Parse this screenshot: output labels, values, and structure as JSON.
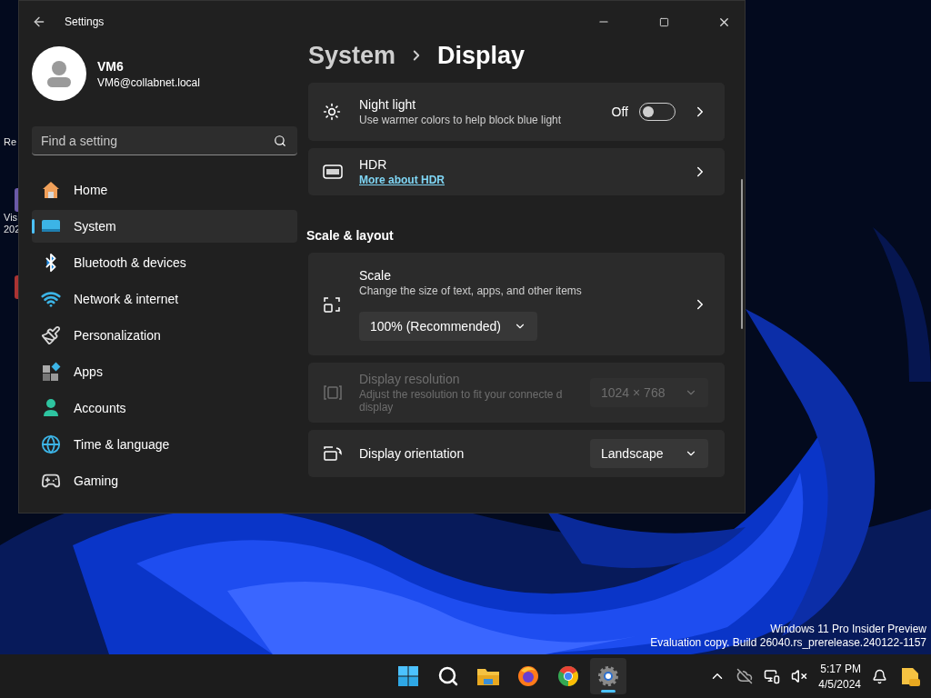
{
  "desktop_icons": [
    {
      "lines": [
        "Re"
      ]
    },
    {
      "lines": [
        "Vis",
        "202"
      ]
    }
  ],
  "window": {
    "title": "Settings"
  },
  "user": {
    "name": "VM6",
    "email": "VM6@collabnet.local"
  },
  "search": {
    "placeholder": "Find a setting"
  },
  "nav": [
    {
      "label": "Home",
      "selected": false
    },
    {
      "label": "System",
      "selected": true
    },
    {
      "label": "Bluetooth & devices",
      "selected": false
    },
    {
      "label": "Network & internet",
      "selected": false
    },
    {
      "label": "Personalization",
      "selected": false
    },
    {
      "label": "Apps",
      "selected": false
    },
    {
      "label": "Accounts",
      "selected": false
    },
    {
      "label": "Time & language",
      "selected": false
    },
    {
      "label": "Gaming",
      "selected": false
    }
  ],
  "breadcrumb": [
    "System",
    "Display"
  ],
  "items": [
    {
      "kind": "toggle",
      "title": "Night light",
      "description": "Use warmer colors to help block blue light",
      "toggle": {
        "label": "Off",
        "on": false
      },
      "chevron": true,
      "disabled": false
    },
    {
      "kind": "link",
      "title": "HDR",
      "link": "More about HDR",
      "chevron": true,
      "disabled": false
    },
    {
      "kind": "heading",
      "title": "Scale & layout"
    },
    {
      "kind": "stacked",
      "title": "Scale",
      "description": "Change the size of text, apps, and other items",
      "dropdown": {
        "value": "100% (Recommended)"
      },
      "chevron": true,
      "disabled": false
    },
    {
      "kind": "inline",
      "title": "Display resolution",
      "description": "Adjust the resolution to fit your connecte d display",
      "dropdown": {
        "value": "1024 × 768"
      },
      "chevron": false,
      "disabled": true
    },
    {
      "kind": "inline",
      "title": "Display orientation",
      "dropdown": {
        "value": "Landscape"
      },
      "chevron": false,
      "disabled": false
    }
  ],
  "watermark": [
    "Windows 11 Pro Insider Preview",
    "Evaluation copy. Build 26040.rs_prerelease.240122-1157"
  ],
  "taskbar": {
    "apps": [
      {
        "selected": false
      },
      {
        "selected": false
      },
      {
        "selected": false
      },
      {
        "selected": false
      },
      {
        "selected": false
      },
      {
        "selected": true
      }
    ],
    "time": "5:17 PM",
    "date": "4/5/2024"
  }
}
